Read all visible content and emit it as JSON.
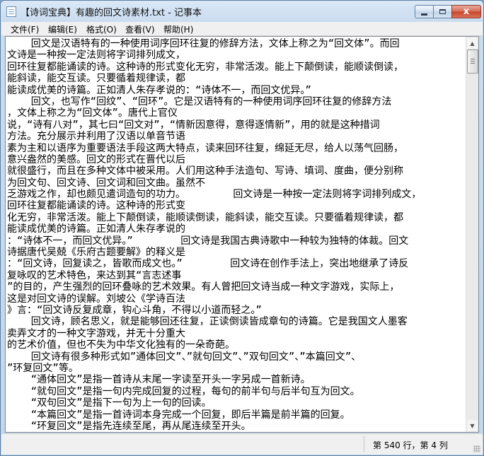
{
  "window": {
    "title": "【诗词宝典】有趣的回文诗素材.txt - 记事本",
    "close_glyph": "x"
  },
  "menu": [
    {
      "label": "文件(F)"
    },
    {
      "label": "编辑(E)"
    },
    {
      "label": "格式(O)"
    },
    {
      "label": "查看(V)"
    },
    {
      "label": "帮助(H)"
    }
  ],
  "editor": {
    "lines": [
      "    回文是汉语特有的一种使用词序回环往复的修辞方法，文体上称之为“回文体”。而回",
      "文诗是一种按一定法则将字词排列成文，",
      "回环往复都能诵读的诗。这种诗的形式变化无穷，非常活泼。能上下颠倒读，能顺读倒读，",
      "能斜读，能交互读。只要循着规律读，都",
      "能读成优美的诗篇。正如清人朱存孝说的：“诗体不一，而回文优异。”",
      "    回文，也写作“回纹”、“回环”。它是汉语特有的一种使用词序回环往复的修辞方法",
      "，文体上称之为“回文体”。唐代上官仪",
      "说，“诗有八对”，其七曰“回文对”，“情新因意得，意得逐情新”，用的就是这种措词",
      "方法。充分展示并利用了汉语以单音节语",
      "素为主和以语序为重要语法手段这两大特点，读来回环往复，绵延无尽，给人以荡气回肠，",
      "意兴盎然的美感。回文的形式在晋代以后",
      "就很盛行，而且在多种文体中被采用。人们用这种手法造句、写诗、填词、度曲，便分别称",
      "为回文句、回文诗、回文词和回文曲。虽然不",
      "乏游戏之作，却也颇见遣词造句的功力。        回文诗是一种按一定法则将字词排列成文，",
      "回环往复都能诵读的诗。这种诗的形式变",
      "化无穷，非常活泼。能上下颠倒读，能顺读倒读，能斜读，能交互读。只要循着规律读，都",
      "能读成优美的诗篇。正如清人朱存孝说的",
      "：“诗体不一，而回文优异。”        回文诗是我国古典诗歌中一种较为独特的体裁。回文",
      "诗据唐代吴兢《乐府古题要解》的释义是",
      "：“回文诗，回复读之，皆歌而成文也。”        回文诗在创作手法上，突出地继承了诗反",
      "复咏叹的艺术特色，来达到其“言志述事",
      "”的目的，产生强烈的回环叠咏的艺术效果。有人曾把回文诗当成一种文字游戏，实际上，",
      "这是对回文诗的误解。刘坡公《学诗百法",
      "》言：“回文诗反复成章，钩心斗角，不得以小道而轻之。”",
      "    回文诗，顾名思义，就是能够回还往复，正读倒读皆成章句的诗篇。它是我国文人墨客",
      "卖弄文才的一种文字游戏，并无十分重大",
      "的艺术价值，但也不失为中华文化独有的一朵奇葩。",
      "    回文诗有很多种形式如”通体回文”、”就句回文”、”双句回文”、”本篇回文”、",
      "”环复回文”等。",
      "    “通体回文”是指一首诗从末尾一字读至开头一字另成一首新诗。",
      "    “就句回文”是指一句内完成回复的过程，每句的前半句与后半句互为回文。",
      "    “双句回文”是指下一句为上一句的回读。",
      "    “本篇回文”是指一首诗词本身完成一个回复，即后半篇是前半篇的回复。",
      "    “环复回文”是指先连续至尾，再从尾连续至开头。"
    ],
    "scroll_up_glyph": "▲",
    "scroll_down_glyph": "▼"
  },
  "status": {
    "position_text": "第 540 行，第 4 列"
  }
}
